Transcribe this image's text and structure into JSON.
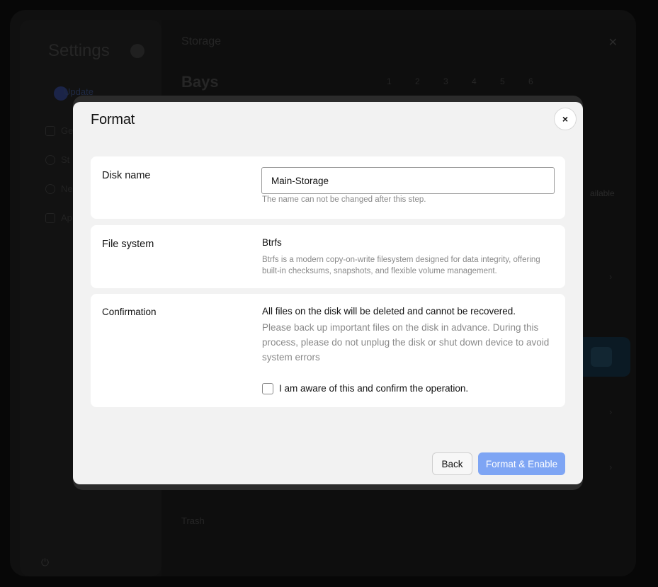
{
  "background": {
    "sidebar_title": "Settings",
    "update_label": "Update",
    "nav_items": [
      "Ge",
      "St",
      "Ne",
      "Ap"
    ],
    "storage_title": "Storage",
    "bays_title": "Bays",
    "bay_numbers": [
      "1",
      "2",
      "3",
      "4",
      "5",
      "6"
    ],
    "available_label": "ailable",
    "trash_label": "Trash"
  },
  "modal": {
    "title": "Format",
    "close_symbol": "×",
    "disk_name": {
      "label": "Disk name",
      "value": "Main-Storage",
      "hint": "The name can not be changed after this step."
    },
    "file_system": {
      "label": "File system",
      "value": "Btrfs",
      "description": "Btrfs is a modern copy-on-write filesystem designed for data integrity, offering built-in checksums, snapshots, and flexible volume management."
    },
    "confirmation": {
      "label": "Confirmation",
      "warning": "All files on the disk will be deleted and cannot be recovered.",
      "description": "Please back up important files on the disk in advance. During this process, please do not unplug the disk or shut down device to avoid system errors",
      "checkbox_label": "I am aware of this and confirm the operation.",
      "checked": false
    },
    "buttons": {
      "back": "Back",
      "format": "Format & Enable"
    }
  },
  "colors": {
    "primary_button": "#7ea5f4",
    "modal_background": "#f2f2f2",
    "card_background": "#ffffff"
  }
}
